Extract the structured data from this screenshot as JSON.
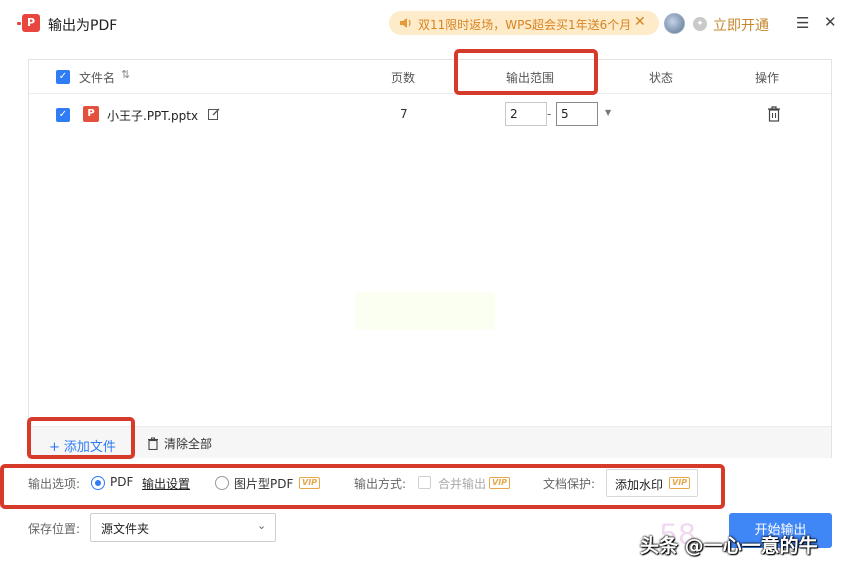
{
  "titlebar": {
    "title": "输出为PDF",
    "logo_letter": "P",
    "promo_text": "双11限时返场，WPS超会买1年送6个月",
    "open_vip_label": "立即开通"
  },
  "table": {
    "headers": {
      "filename": "文件名",
      "pages": "页数",
      "range": "输出范围",
      "status": "状态",
      "actions": "操作"
    },
    "rows": [
      {
        "checked": true,
        "name": "小王子.PPT.pptx",
        "file_icon_letter": "P",
        "pages": "7",
        "range_from": "2",
        "range_sep": "-",
        "range_to": "5",
        "status": ""
      }
    ],
    "footer": {
      "add_file_icon": "+",
      "add_file_label": "添加文件",
      "clear_all_label": "清除全部"
    }
  },
  "options": {
    "output_options_label": "输出选项:",
    "pdf_label": "PDF",
    "pdf_selected": true,
    "output_settings_link": "输出设置",
    "image_pdf_label": "图片型PDF",
    "vip_tag": "VIP",
    "output_mode_label": "输出方式:",
    "merge_output_label": "合并输出",
    "protection_label": "文档保护:",
    "add_watermark_label": "添加水印"
  },
  "save": {
    "label": "保存位置:",
    "location_value": "源文件夹"
  },
  "start_button_label": "开始输出",
  "overlay": {
    "digits": "58",
    "source_watermark": "头条 @一心一意的牛"
  },
  "colors": {
    "accent_blue": "#2f7cf6",
    "button_blue": "#3f86f7",
    "highlight_red": "#d63a2a",
    "promo_bg": "#fdebc9",
    "promo_text": "#d88322",
    "vip_gold": "#c7872d"
  },
  "icons": {
    "app": "pdf-app-icon",
    "promo": "speaker-icon",
    "sort": "sort-icon",
    "edit": "edit-icon",
    "delete": "trash-icon",
    "add": "plus-icon",
    "clear": "trash-icon",
    "dropdown": "chevron-down-icon",
    "menu": "hamburger-icon",
    "close": "close-icon"
  }
}
